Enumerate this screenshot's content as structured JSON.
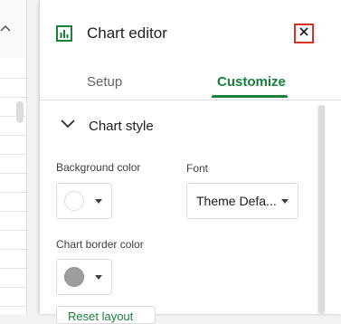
{
  "panel": {
    "title": "Chart editor",
    "close_icon": "close-icon",
    "chart_icon": "bar-chart-icon"
  },
  "tabs": [
    {
      "label": "Setup",
      "active": false
    },
    {
      "label": "Customize",
      "active": true
    }
  ],
  "section": {
    "title": "Chart style",
    "expanded": true
  },
  "fields": {
    "background_color_label": "Background color",
    "font_label": "Font",
    "font_value": "Theme Defa...",
    "border_color_label": "Chart border color",
    "reset_label": "Reset layout"
  },
  "colors": {
    "accent": "#188038",
    "close_highlight": "#d93025",
    "background_swatch": "#ffffff",
    "border_swatch": "#9e9e9e"
  }
}
